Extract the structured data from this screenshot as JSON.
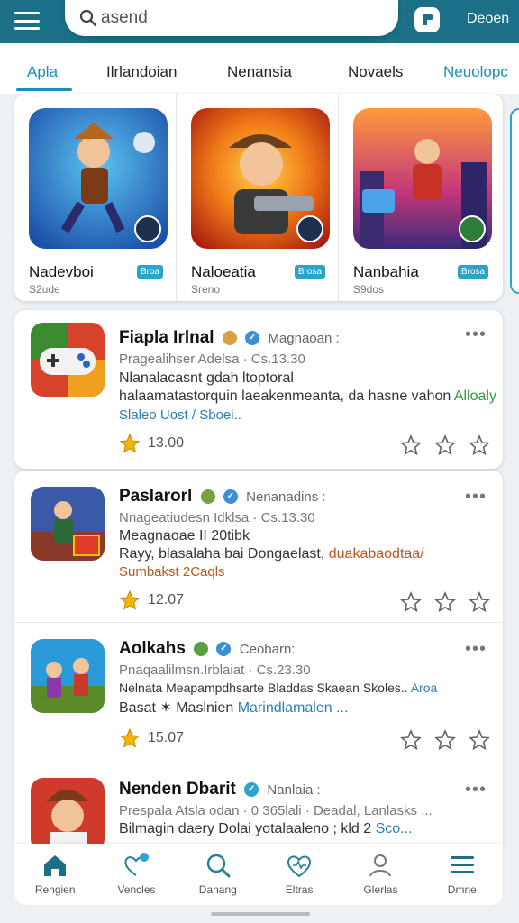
{
  "header": {
    "search_text": "asend",
    "right_label": "Deoen"
  },
  "tabs": [
    {
      "label": "Apla"
    },
    {
      "label": "Ilrlandoian"
    },
    {
      "label": "Nenansia"
    },
    {
      "label": "Novaels"
    },
    {
      "label": "Neuolopc"
    }
  ],
  "featured": [
    {
      "name": "Nadevboi",
      "badge": "Broa",
      "sub": "S2ude"
    },
    {
      "name": "Naloeatia",
      "badge": "Brosa",
      "sub": "Sreno"
    },
    {
      "name": "Nanbahia",
      "badge": "Brosa",
      "sub": "S9dos"
    }
  ],
  "list": [
    {
      "title": "Fiapla Irlnal",
      "publisher": "Magnaoan :",
      "meta": "Pragealihser Adelsa · Cs.13.30",
      "desc1": "Nlanalacasnt gdah ltoptoral",
      "desc2": "halaamatastorquin laeakenmeanta, da hasne vahon",
      "desc2_accent": "Alloaly",
      "link": "Slaleo Uost / Sboei..",
      "rating": "13.00"
    },
    {
      "title": "Paslarorl",
      "publisher": "Nenanadins :",
      "meta": "Nnageatiudesn Idklsa · Cs.13.30",
      "desc1": "Meagnaoae II 20tibk",
      "desc2": "Rayy, blasalaha bai Dongaelast,",
      "desc2_accent": "duakabaodtaa/",
      "link": "Sumbakst 2Caqls",
      "rating": "12.07"
    },
    {
      "title": "Aolkahs",
      "publisher": "Ceobarn:",
      "meta": "Pnaqaalilmsn.Irblaiat · Cs.23.30",
      "desc1": "Nelnata Meapampdhsarte Bladdas Skaean Skoles..",
      "desc1_accent": "Aroa",
      "desc2": "Basat ✶ Maslnien",
      "desc2_accent": "Marindlamalen ...",
      "link": "",
      "rating": "15.07"
    },
    {
      "title": "Nenden Dbarit",
      "publisher": "Nanlaia :",
      "meta": "Prespala Atsla odan · 0 365lali · Deadal, Lanlasks ...",
      "desc1": "Bilmagin daery Dolai yotalaaleno ; kld 2",
      "desc1_accent": "Sco...",
      "desc2": "",
      "link": "",
      "rating": ""
    }
  ],
  "bottom_nav": [
    {
      "label": "Rengien",
      "icon": "home-icon"
    },
    {
      "label": "Vencles",
      "icon": "heart-search-icon"
    },
    {
      "label": "Danang",
      "icon": "search-icon"
    },
    {
      "label": "Eltras",
      "icon": "heart-icon"
    },
    {
      "label": "Glerlas",
      "icon": "profile-icon"
    },
    {
      "label": "Dmne",
      "icon": "menu-icon"
    }
  ],
  "colors": {
    "topbar": "#1b6f86",
    "accent": "#1a8fb8",
    "star": "#f2b705"
  }
}
